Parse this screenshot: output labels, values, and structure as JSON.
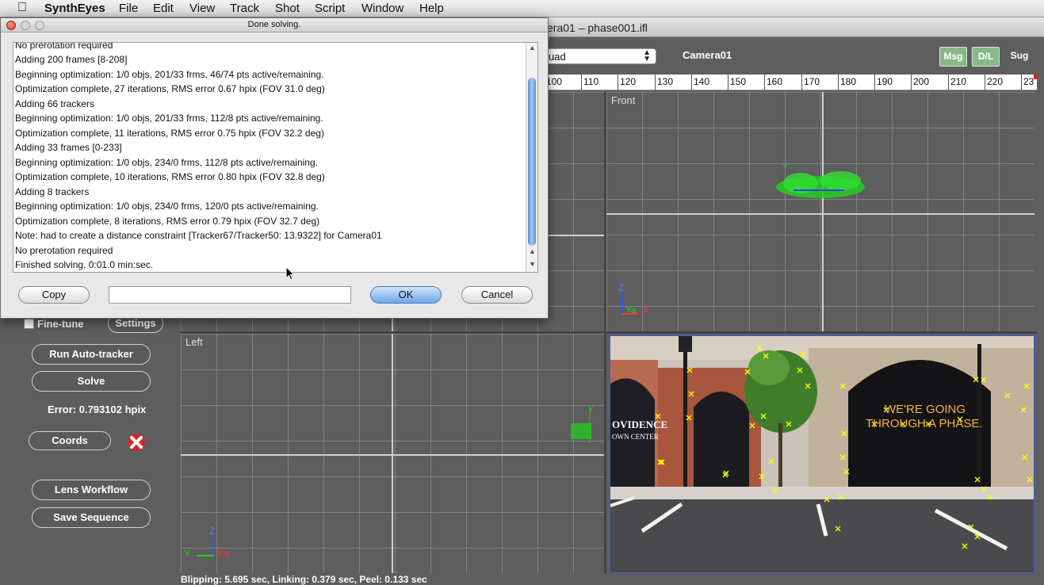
{
  "menubar": {
    "app_name": "SynthEyes",
    "items": [
      "File",
      "Edit",
      "View",
      "Track",
      "Shot",
      "Script",
      "Window",
      "Help"
    ]
  },
  "window": {
    "title": "era01 – phase001.ifl"
  },
  "toolbar": {
    "view_select": "uad",
    "camera_label": "Camera01",
    "msg_button": "Msg",
    "dl_button": "D/L",
    "sug_button": "Sug"
  },
  "ruler": {
    "ticks": [
      "100",
      "110",
      "120",
      "130",
      "140",
      "150",
      "160",
      "170",
      "180",
      "190",
      "200",
      "210",
      "220",
      "23"
    ]
  },
  "dialog": {
    "title": "Done solving.",
    "log_lines": [
      "No prerotation required",
      "Adding 200 frames [8-208]",
      "Beginning optimization: 1/0 objs, 201/33 frms, 46/74 pts active/remaining.",
      "Optimization complete, 27 iterations, RMS error 0.67 hpix (FOV 31.0 deg)",
      "Adding 66 trackers",
      "Beginning optimization: 1/0 objs, 201/33 frms, 112/8 pts active/remaining.",
      "Optimization complete, 11 iterations, RMS error 0.75 hpix (FOV 32.2 deg)",
      "Adding 33 frames [0-233]",
      "Beginning optimization: 1/0 objs, 234/0 frms, 112/8 pts active/remaining.",
      "Optimization complete, 10 iterations, RMS error 0.80 hpix (FOV 32.8 deg)",
      "Adding 8 trackers",
      "Beginning optimization: 1/0 objs, 234/0 frms, 120/0 pts active/remaining.",
      "Optimization complete, 8 iterations, RMS error 0.79 hpix (FOV 32.7 deg)",
      "Note: had to create a distance constraint [Tracker67/Tracker50: 13.9322] for Camera01",
      "No prerotation required",
      "Finished solving, 0:01.0 min:sec."
    ],
    "copy_button": "Copy",
    "text_field_value": "",
    "ok_button": "OK",
    "cancel_button": "Cancel"
  },
  "left_panel": {
    "fine_tune_label": "Fine-tune",
    "settings_button": "Settings",
    "run_autotracker_button": "Run Auto-tracker",
    "solve_button": "Solve",
    "error_text": "Error: 0.793102 hpix",
    "coords_button": "Coords",
    "lens_workflow_button": "Lens Workflow",
    "save_sequence_button": "Save Sequence"
  },
  "viewports": {
    "front_label": "Front",
    "left_label": "Left",
    "front_axis_z": "Z",
    "front_axis_ya": "Ya",
    "front_axis_x": "X",
    "left_axis_z": "Z",
    "left_axis_y": "Y",
    "left_axis_x": "Xa"
  },
  "camera_view": {
    "sign_text_1": "WE'RE GOING",
    "sign_text_2": "THROUGH A PHASE.",
    "store_text_1": "OVIDENCE",
    "store_text_2": "OWN CENTER"
  },
  "status": {
    "text": "Blipping: 5.695 sec, Linking: 0.379 sec, Peel: 0.133 sec"
  },
  "colors": {
    "msg_active": "#8ab88a",
    "dl_active": "#8ab88a",
    "tracker_yellow": "#ffff00",
    "point_green": "#22cc22",
    "ok_button_blue": "#6fa6ea"
  }
}
